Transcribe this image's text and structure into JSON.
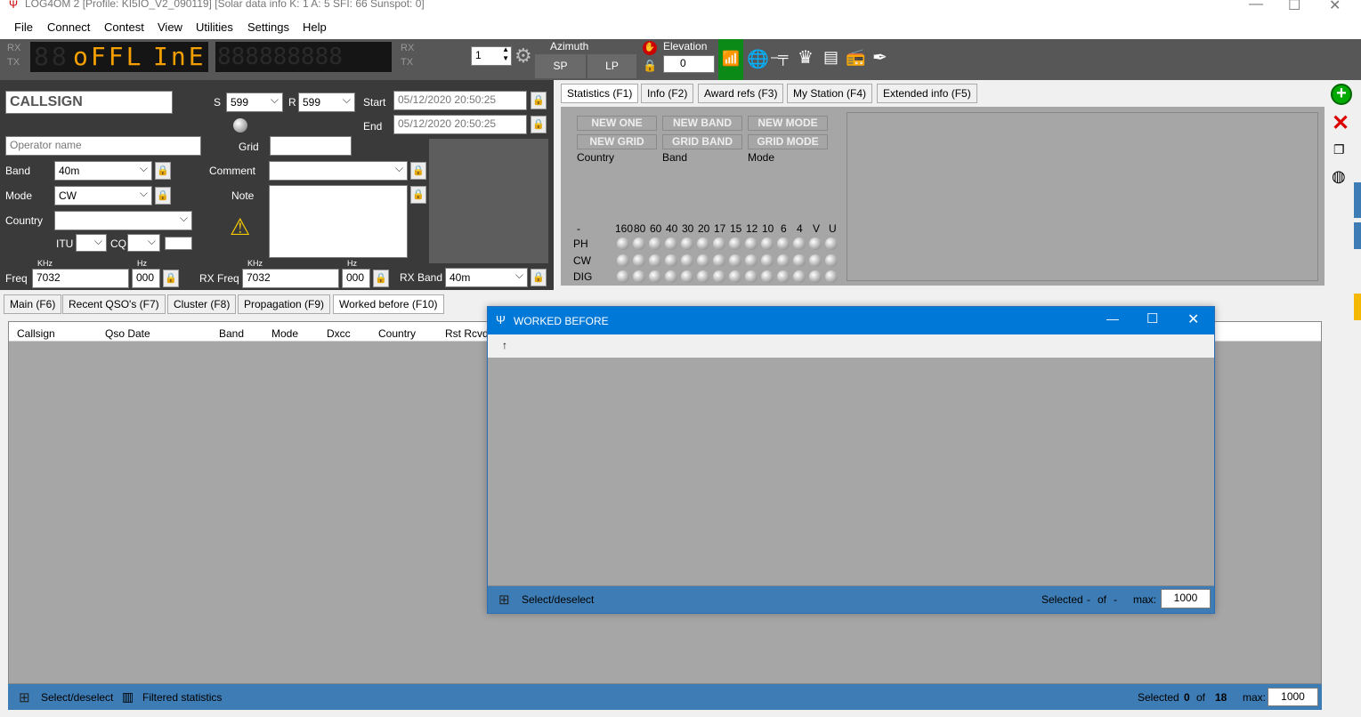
{
  "app": {
    "title": "LOG4OM 2 [Profile: KI5IO_V2_090119] [Solar data info K: 1 A: 5 SFI: 66 Sunspot: 0]"
  },
  "menu": [
    "File",
    "Connect",
    "Contest",
    "View",
    "Utilities",
    "Settings",
    "Help"
  ],
  "toolbar": {
    "rx": "RX",
    "tx": "TX",
    "rx2": "RX",
    "tx2": "TX",
    "lcd_off": "88",
    "lcd_on": "oFFL",
    "lcd_on2": "InE",
    "lcd2": "888888888",
    "spin": "1",
    "azimuth": "Azimuth",
    "sp": "SP",
    "lp": "LP",
    "elevation": "Elevation",
    "elev_val": "0"
  },
  "entry": {
    "callsign_placeholder": "CALLSIGN",
    "s_label": "S",
    "s_value": "599",
    "r_label": "R",
    "r_value": "599",
    "start_label": "Start",
    "start_value": "05/12/2020 20:50:25",
    "end_label": "End",
    "end_value": "05/12/2020 20:50:25",
    "operator_placeholder": "Operator name",
    "grid_label": "Grid",
    "band_label": "Band",
    "band_value": "40m",
    "comment_label": "Comment",
    "mode_label": "Mode",
    "mode_value": "CW",
    "note_label": "Note",
    "country_label": "Country",
    "itu_label": "ITU",
    "cq_label": "CQ",
    "khz1": "KHz",
    "hz1": "Hz",
    "freq_label": "Freq",
    "freq_value": "7032",
    "freq_hz": "000",
    "khz2": "KHz",
    "hz2": "Hz",
    "rxfreq_label": "RX Freq",
    "rxfreq_value": "7032",
    "rxfreq_hz": "000",
    "rxband_label": "RX Band",
    "rxband_value": "40m"
  },
  "right_tabs": [
    "Statistics (F1)",
    "Info (F2)",
    "Award refs (F3)",
    "My Station (F4)",
    "Extended info (F5)"
  ],
  "stats": {
    "buttons": [
      "NEW ONE",
      "NEW BAND",
      "NEW MODE",
      "NEW GRID",
      "GRID BAND",
      "GRID MODE"
    ],
    "country": "Country",
    "band": "Band",
    "mode": "Mode",
    "dash": "-",
    "bands": [
      "160",
      "80",
      "60",
      "40",
      "30",
      "20",
      "17",
      "15",
      "12",
      "10",
      "6",
      "4",
      "V",
      "U"
    ],
    "rows": [
      "PH",
      "CW",
      "DIG"
    ]
  },
  "bottom_tabs": [
    "Main (F6)",
    "Recent QSO's (F7)",
    "Cluster (F8)",
    "Propagation (F9)",
    "Worked before (F10)"
  ],
  "table": {
    "headers": [
      "Callsign",
      "Qso Date",
      "Band",
      "Mode",
      "Dxcc",
      "Country",
      "Rst Rcvd"
    ]
  },
  "status": {
    "select": "Select/deselect",
    "filtered": "Filtered statistics",
    "selected": "Selected",
    "count": "0",
    "of": "of",
    "total": "18",
    "max_label": "max:",
    "max_value": "1000"
  },
  "popup": {
    "title": "WORKED BEFORE",
    "arrow": "↑",
    "select": "Select/deselect",
    "selected": "Selected",
    "dash1": "-",
    "of": "of",
    "dash2": "-",
    "max_label": "max:",
    "max_value": "1000"
  }
}
